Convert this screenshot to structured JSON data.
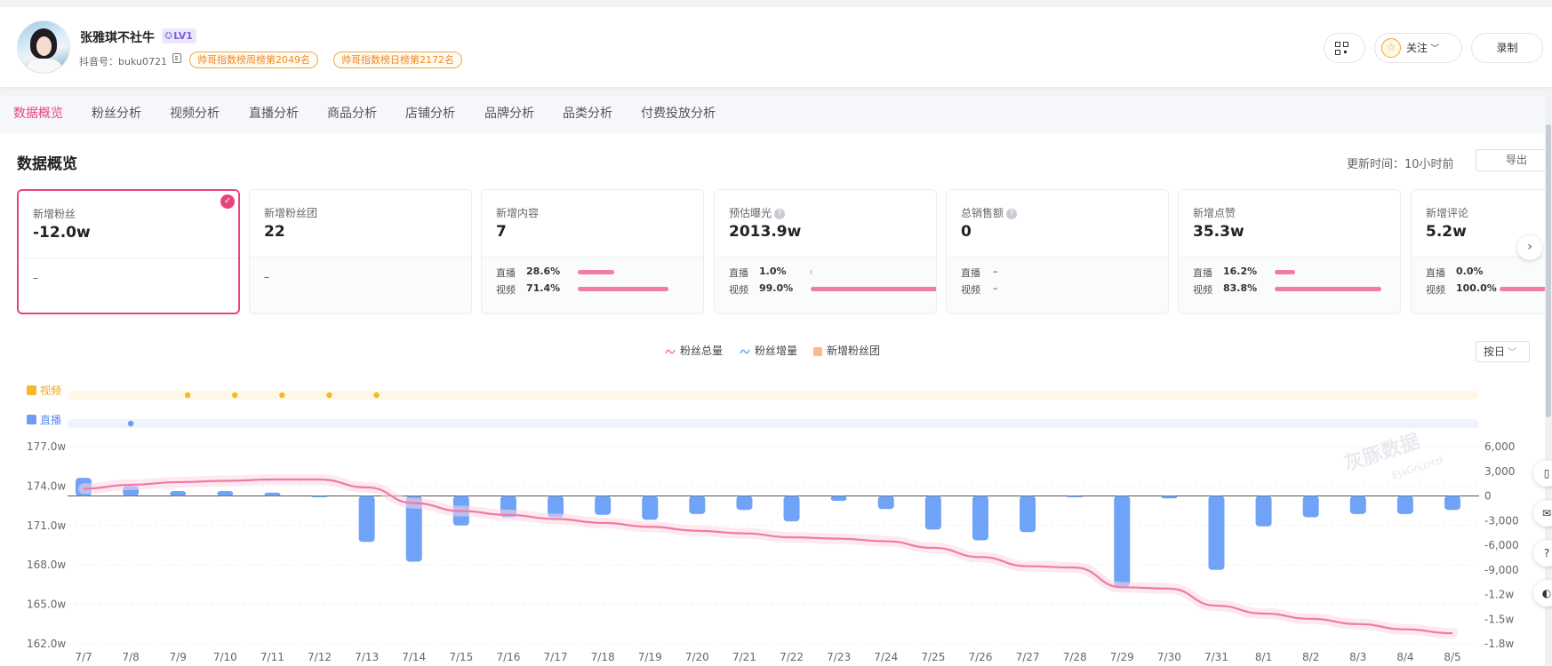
{
  "profile": {
    "name": "张雅琪不社牛",
    "level": "LV1",
    "douyin_label": "抖音号：buku0721",
    "badges": [
      "帅哥指数榜周榜第2049名",
      "帅哥指数榜日榜第2172名"
    ],
    "follow_label": "关注",
    "record_label": "录制"
  },
  "tabs": [
    "数据概览",
    "粉丝分析",
    "视频分析",
    "直播分析",
    "商品分析",
    "店铺分析",
    "品牌分析",
    "品类分析",
    "付费投放分析"
  ],
  "overview": {
    "title": "数据概览",
    "update_time": "更新时间：10小时前",
    "export_label": "导出"
  },
  "cards": [
    {
      "label": "新增粉丝",
      "value": "-12.0w",
      "dash": "–",
      "selected": true,
      "has_help": false
    },
    {
      "label": "新增粉丝团",
      "value": "22",
      "dash": "–",
      "selected": false,
      "has_help": false
    },
    {
      "label": "新增内容",
      "value": "7",
      "rows": [
        {
          "l": "直播",
          "v": "28.6%",
          "pct": 28.6
        },
        {
          "l": "视频",
          "v": "71.4%",
          "pct": 71.4
        }
      ],
      "has_help": false
    },
    {
      "label": "预估曝光",
      "value": "2013.9w",
      "rows": [
        {
          "l": "直播",
          "v": "1.0%",
          "pct": 1.0
        },
        {
          "l": "视频",
          "v": "99.0%",
          "pct": 99.0
        }
      ],
      "has_help": true
    },
    {
      "label": "总销售额",
      "value": "0",
      "rows": [
        {
          "l": "直播",
          "v": "–",
          "pct": 0
        },
        {
          "l": "视频",
          "v": "–",
          "pct": 0
        }
      ],
      "has_help": true
    },
    {
      "label": "新增点赞",
      "value": "35.3w",
      "rows": [
        {
          "l": "直播",
          "v": "16.2%",
          "pct": 16.2
        },
        {
          "l": "视频",
          "v": "83.8%",
          "pct": 83.8
        }
      ],
      "has_help": false
    },
    {
      "label": "新增评论",
      "value": "5.2w",
      "rows": [
        {
          "l": "直播",
          "v": "0.0%",
          "pct": 0
        },
        {
          "l": "视频",
          "v": "100.0%",
          "pct": 100
        }
      ],
      "has_help": false
    }
  ],
  "legend": {
    "total": "粉丝总量",
    "increase": "粉丝增量",
    "fanclub": "新增粉丝团"
  },
  "period_select": "按日",
  "lanes": {
    "video_label": "视频",
    "live_label": "直播"
  },
  "watermark": {
    "main": "灰豚数据",
    "sub": "EJaGnjzHzF"
  },
  "side_tools": [
    "phone-icon",
    "mail-icon",
    "help-icon",
    "wechat-icon"
  ],
  "colors": {
    "accent": "#e8447a",
    "bar": "#6fa3f7",
    "line": "#f07aa4",
    "video_dot": "#f5b826",
    "live_dot": "#6f9bf0"
  },
  "chart_data": {
    "type": "bar+line",
    "categories": [
      "7/7",
      "7/8",
      "7/9",
      "7/10",
      "7/11",
      "7/12",
      "7/13",
      "7/14",
      "7/15",
      "7/16",
      "7/17",
      "7/18",
      "7/19",
      "7/20",
      "7/21",
      "7/22",
      "7/23",
      "7/24",
      "7/25",
      "7/26",
      "7/27",
      "7/28",
      "7/29",
      "7/30",
      "7/31",
      "8/1",
      "8/2",
      "8/3",
      "8/4",
      "8/5"
    ],
    "series": [
      {
        "name": "粉丝增量",
        "axis": "right",
        "values": [
          2200,
          1200,
          600,
          600,
          400,
          -100,
          -5600,
          -8000,
          -3600,
          -2600,
          -2600,
          -2300,
          -2900,
          -2200,
          -1700,
          -3100,
          -600,
          -1600,
          -4100,
          -5400,
          -4400,
          -100,
          -11000,
          -300,
          -9000,
          -3700,
          -2600,
          -2200,
          -2200,
          -1700
        ]
      },
      {
        "name": "粉丝总量",
        "axis": "left",
        "values": [
          173.8,
          174.1,
          174.3,
          174.4,
          174.5,
          174.5,
          173.9,
          172.7,
          172.1,
          171.8,
          171.5,
          171.2,
          170.9,
          170.6,
          170.4,
          170.1,
          170.0,
          169.8,
          169.3,
          168.6,
          167.9,
          167.8,
          166.3,
          166.2,
          164.9,
          164.3,
          163.9,
          163.5,
          163.1,
          162.8
        ]
      }
    ],
    "video_events": [
      "7/8",
      "7/9",
      "7/10",
      "7/11",
      "7/12"
    ],
    "live_events": [
      "7/8"
    ],
    "left_axis": {
      "ticks": [
        "177.0w",
        "174.0w",
        "171.0w",
        "168.0w",
        "165.0w",
        "162.0w"
      ],
      "range": [
        162.0,
        177.0
      ]
    },
    "right_axis": {
      "ticks": [
        "6,000",
        "3,000",
        "0",
        "-3,000",
        "-6,000",
        "-9,000",
        "-1.2w",
        "-1.5w",
        "-1.8w"
      ],
      "range": [
        -18000,
        6000
      ]
    },
    "grid": true,
    "legend_position": "top-center"
  }
}
